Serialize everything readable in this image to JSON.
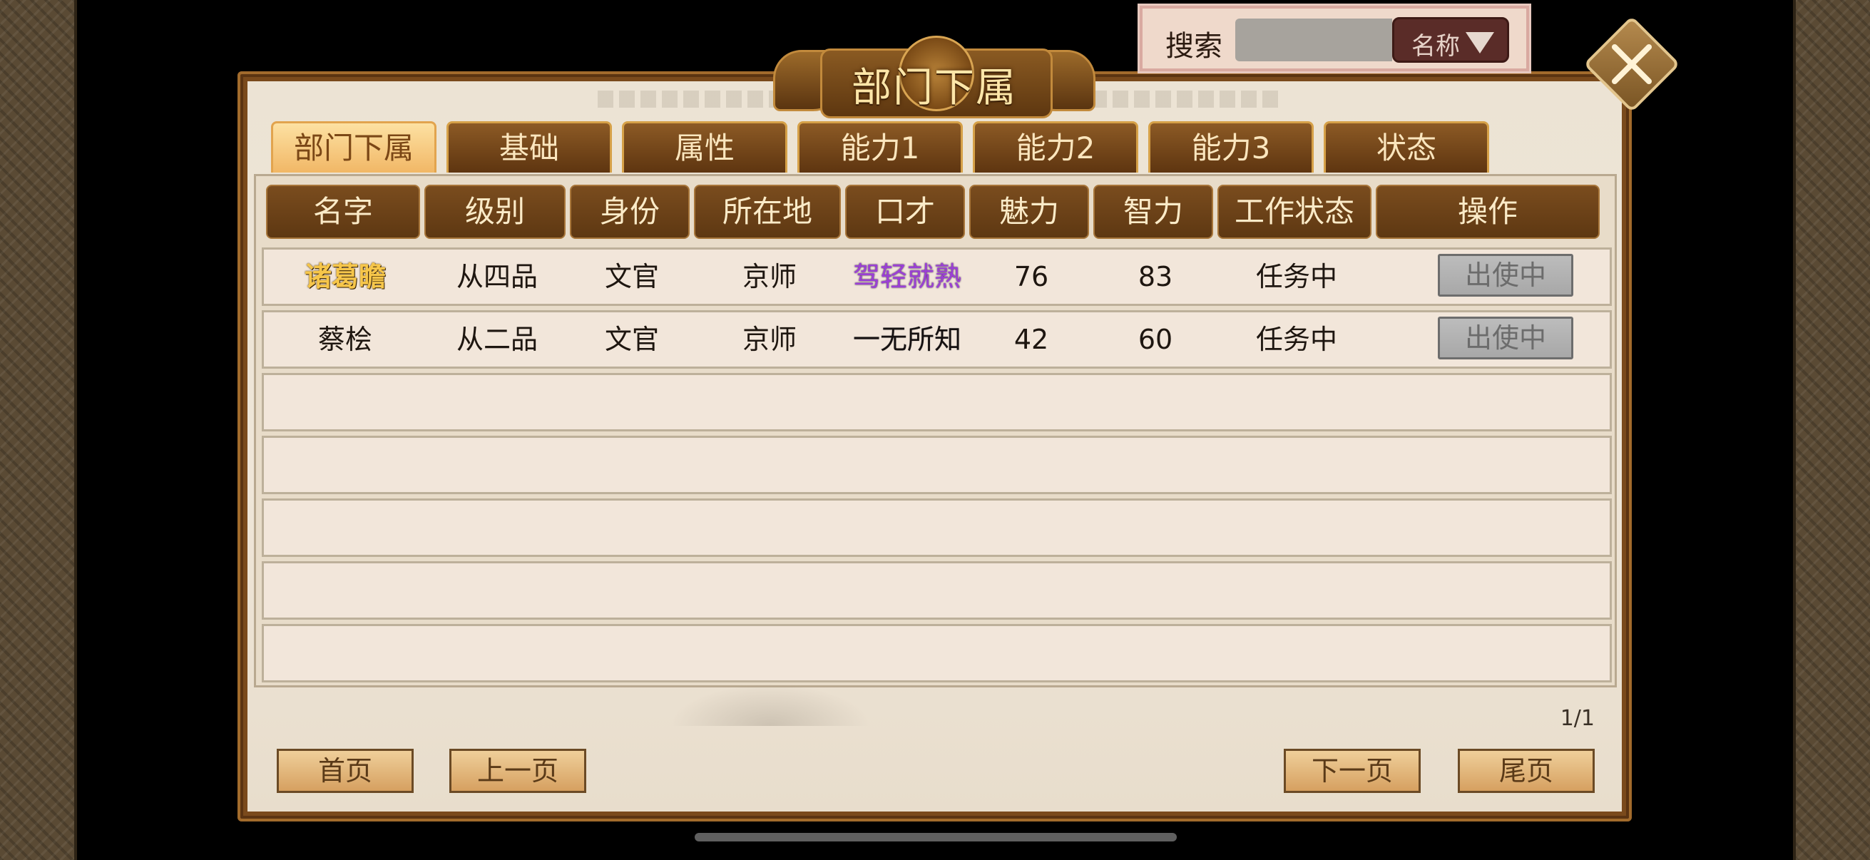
{
  "title": "部门下属",
  "search": {
    "label": "搜索",
    "value": "",
    "placeholder": "",
    "filter_label": "名称"
  },
  "tabs": [
    {
      "label": "部门下属",
      "active": true
    },
    {
      "label": "基础",
      "active": false
    },
    {
      "label": "属性",
      "active": false
    },
    {
      "label": "能力1",
      "active": false
    },
    {
      "label": "能力2",
      "active": false
    },
    {
      "label": "能力3",
      "active": false
    },
    {
      "label": "状态",
      "active": false
    }
  ],
  "table": {
    "columns": [
      "名字",
      "级别",
      "身份",
      "所在地",
      "口才",
      "魅力",
      "智力",
      "工作状态",
      "操作"
    ],
    "rows": [
      {
        "name": "诸葛瞻",
        "rank": "从四品",
        "identity": "文官",
        "location": "京师",
        "eloquence": "驾轻就熟",
        "charm": "76",
        "intelligence": "83",
        "status": "任务中",
        "action": "出使中"
      },
      {
        "name": "蔡桧",
        "rank": "从二品",
        "identity": "文官",
        "location": "京师",
        "eloquence": "一无所知",
        "charm": "42",
        "intelligence": "60",
        "status": "任务中",
        "action": "出使中"
      }
    ]
  },
  "pagination": {
    "indicator": "1/1",
    "first": "首页",
    "prev": "上一页",
    "next": "下一页",
    "last": "尾页"
  },
  "colors": {
    "frame": "#7a4a1c",
    "parchment": "#ece3d4",
    "header_cell": "#6a401a",
    "name_highlight": "#f6c64a",
    "skill_highlight": "#9b3fd6"
  }
}
